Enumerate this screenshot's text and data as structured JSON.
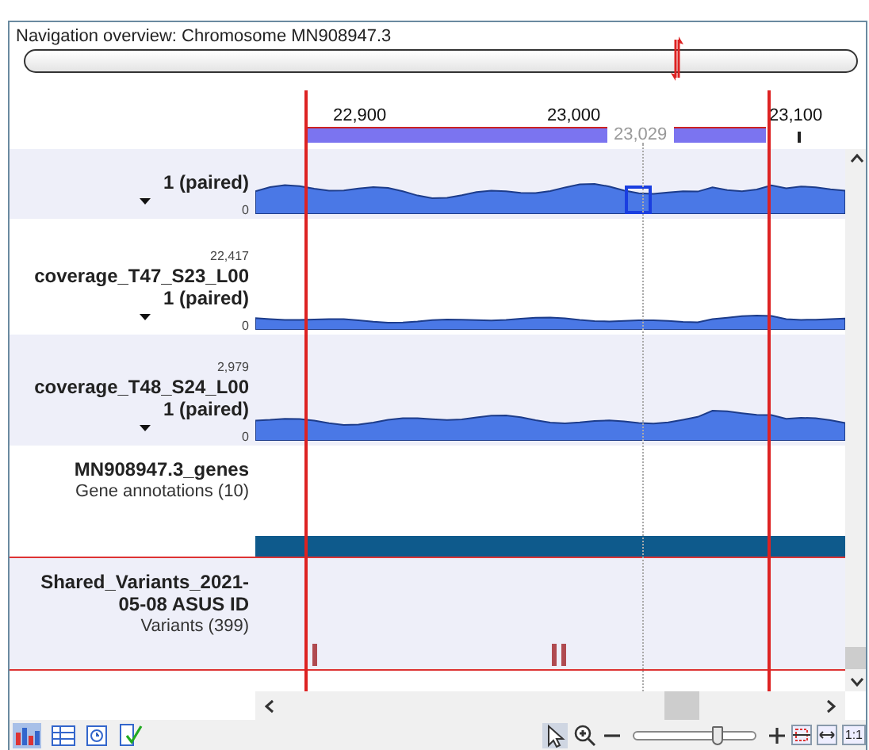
{
  "navigation": {
    "title": "Navigation overview: Chromosome MN908947.3"
  },
  "ruler": {
    "ticks": [
      "22,900",
      "23,000",
      "23,100"
    ],
    "cursor": "23,029"
  },
  "tracks": [
    {
      "kind": "coverage",
      "name_lines": [
        "1 (paired)"
      ],
      "zero": "0"
    },
    {
      "kind": "coverage",
      "max": "22,417",
      "name_lines": [
        "coverage_T47_S23_L00",
        "1 (paired)"
      ],
      "zero": "0"
    },
    {
      "kind": "coverage",
      "max": "2,979",
      "name_lines": [
        "coverage_T48_S24_L00",
        "1 (paired)"
      ],
      "zero": "0"
    },
    {
      "kind": "genes",
      "name_lines": [
        "MN908947.3_genes"
      ],
      "subtitle": "Gene annotations (10)"
    },
    {
      "kind": "variants",
      "name_lines": [
        "Shared_Variants_2021-",
        "05-08 ASUS ID"
      ],
      "subtitle": "Variants (399)"
    }
  ],
  "toolbar": {
    "zoom": {
      "level": 0.7
    },
    "fit_label": "1:1",
    "pointer_selected": true,
    "graph_view_selected": true
  }
}
